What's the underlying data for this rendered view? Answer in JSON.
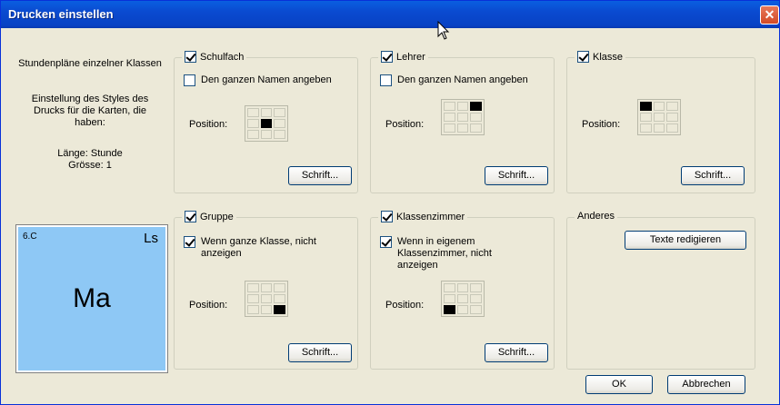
{
  "window": {
    "title": "Drucken einstellen",
    "close_glyph": "✕"
  },
  "info": {
    "line1": "Stundenpläne einzelner Klassen",
    "line2": "Einstellung des Styles des Drucks für die Karten, die haben:",
    "line3": "Länge: Stunde",
    "line4": "Grösse: 1"
  },
  "preview": {
    "class": "6.C",
    "teacher": "Ls",
    "subject": "Ma",
    "bg_color": "#8ec8f5"
  },
  "common": {
    "position_label": "Position:",
    "font_button": "Schrift..."
  },
  "schulfach": {
    "label": "Schulfach",
    "checked": true,
    "option": "Den ganzen Namen angeben",
    "option_checked": false,
    "active_cell": 4
  },
  "lehrer": {
    "label": "Lehrer",
    "checked": true,
    "option": "Den ganzen Namen angeben",
    "option_checked": false,
    "active_cell": 2
  },
  "klasse": {
    "label": "Klasse",
    "checked": true,
    "active_cell": 0
  },
  "gruppe": {
    "label": "Gruppe",
    "checked": true,
    "option": "Wenn ganze Klasse, nicht anzeigen",
    "option_checked": true,
    "active_cell": 8
  },
  "klassenzimmer": {
    "label": "Klassenzimmer",
    "checked": true,
    "option": "Wenn in eigenem Klassenzimmer, nicht anzeigen",
    "option_checked": true,
    "active_cell": 6
  },
  "anderes": {
    "label": "Anderes",
    "button": "Texte redigieren"
  },
  "footer": {
    "ok": "OK",
    "cancel": "Abbrechen"
  }
}
